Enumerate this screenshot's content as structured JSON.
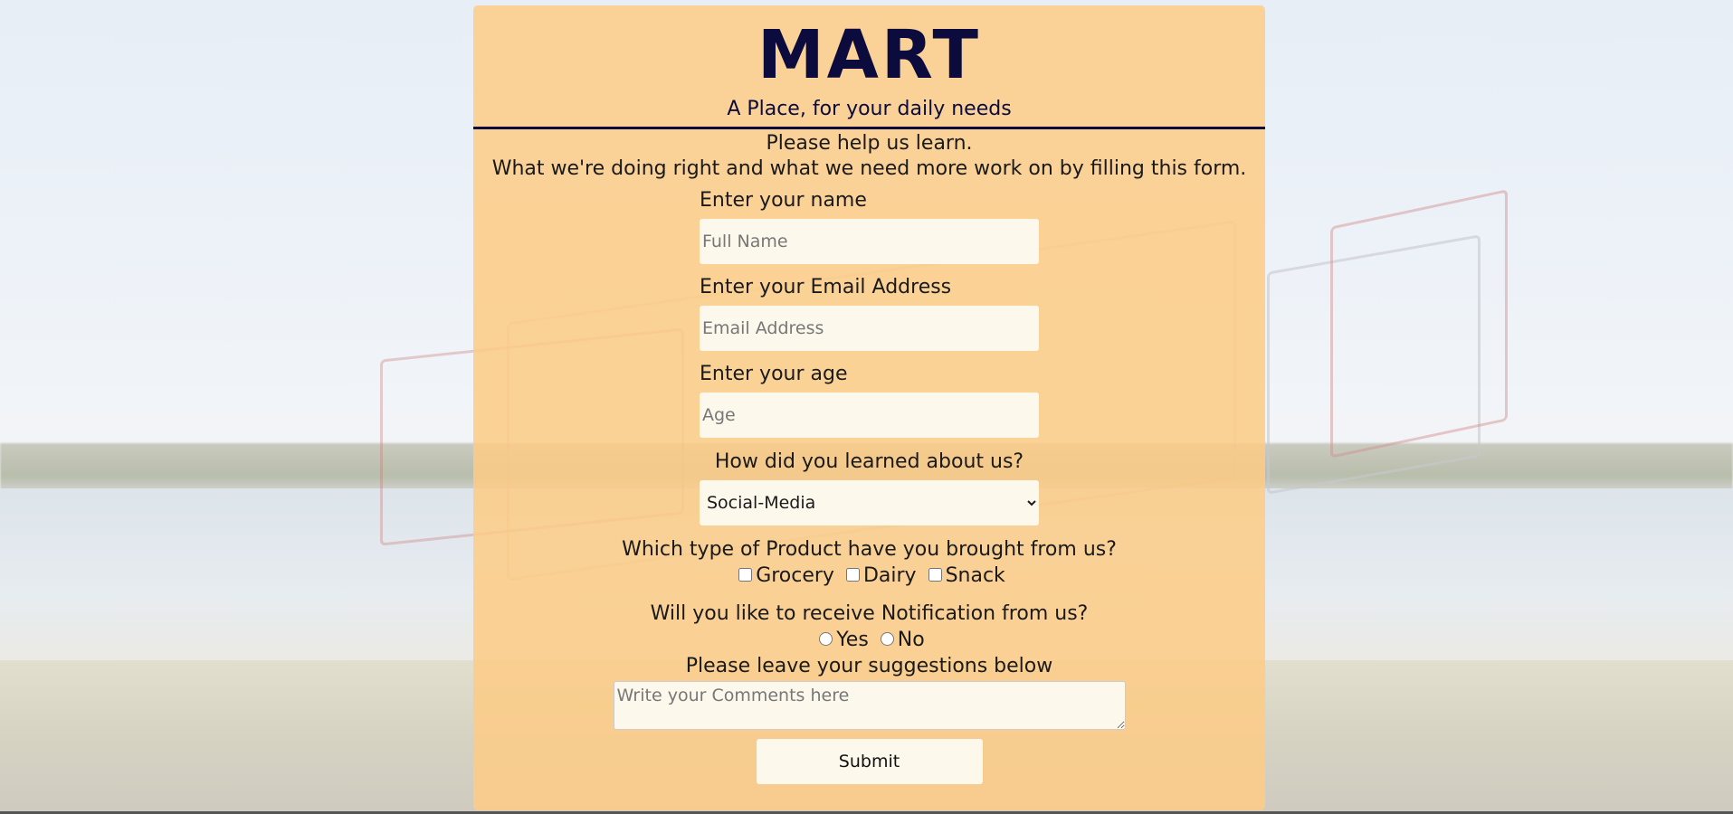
{
  "header": {
    "title": "MART",
    "tagline": "A Place, for your daily needs"
  },
  "intro": {
    "line1": "Please help us learn.",
    "line2": "What we're doing right and what we need more work on by filling this form."
  },
  "form": {
    "name": {
      "label": "Enter your name",
      "placeholder": "Full Name",
      "value": ""
    },
    "email": {
      "label": "Enter your Email Address",
      "placeholder": "Email Address",
      "value": ""
    },
    "age": {
      "label": "Enter your age",
      "placeholder": "Age",
      "value": ""
    },
    "source": {
      "label": "How did you learned about us?",
      "selected": "Social-Media"
    },
    "products": {
      "label": "Which type of Product have you brought from us?",
      "options": [
        "Grocery",
        "Dairy",
        "Snack"
      ],
      "checked": [
        false,
        false,
        false
      ]
    },
    "notification": {
      "label": "Will you like to receive Notification from us?",
      "options": [
        "Yes",
        "No"
      ],
      "selected": null
    },
    "comments": {
      "label": "Please leave your suggestions below",
      "placeholder": "Write your Comments here",
      "value": ""
    },
    "submit_label": "Submit"
  },
  "colors": {
    "card_bg": "#fdcc86",
    "title_color": "#0b0b3e",
    "field_bg": "#fdf8ec"
  }
}
